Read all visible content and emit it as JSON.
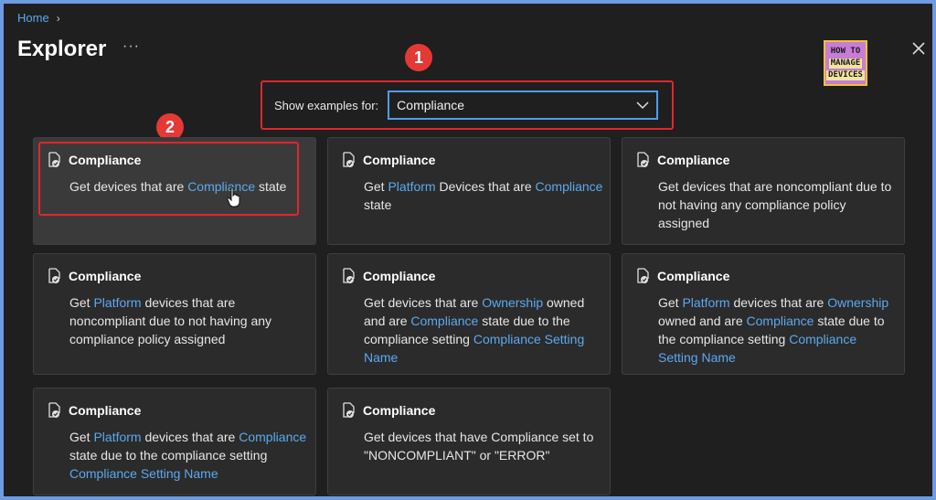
{
  "breadcrumb": {
    "home": "Home"
  },
  "header": {
    "title": "Explorer",
    "more": "···"
  },
  "logo": {
    "line1": "HOW TO",
    "line2": "MANAGE",
    "line3": "DEVICES"
  },
  "selector": {
    "label": "Show examples for:",
    "value": "Compliance"
  },
  "annotations": {
    "badge1": "1",
    "badge2": "2"
  },
  "cards": [
    {
      "title": "Compliance",
      "desc": [
        {
          "t": "Get devices that are "
        },
        {
          "t": "Compliance",
          "hl": true
        },
        {
          "t": " state"
        }
      ]
    },
    {
      "title": "Compliance",
      "desc": [
        {
          "t": "Get "
        },
        {
          "t": "Platform",
          "hl": true
        },
        {
          "t": " Devices that are "
        },
        {
          "t": "Compliance",
          "hl": true
        },
        {
          "t": " state"
        }
      ]
    },
    {
      "title": "Compliance",
      "desc": [
        {
          "t": "Get devices that are noncompliant due to not having any compliance policy assigned"
        }
      ]
    },
    {
      "title": "Compliance",
      "desc": [
        {
          "t": "Get "
        },
        {
          "t": "Platform",
          "hl": true
        },
        {
          "t": " devices that are noncompliant due to not having any compliance policy assigned"
        }
      ]
    },
    {
      "title": "Compliance",
      "desc": [
        {
          "t": "Get devices that are "
        },
        {
          "t": "Ownership",
          "hl": true
        },
        {
          "t": " owned and are "
        },
        {
          "t": "Compliance",
          "hl": true
        },
        {
          "t": " state due to the compliance setting "
        },
        {
          "t": "Compliance Setting Name",
          "hl": true
        }
      ]
    },
    {
      "title": "Compliance",
      "desc": [
        {
          "t": "Get "
        },
        {
          "t": "Platform",
          "hl": true
        },
        {
          "t": " devices that are "
        },
        {
          "t": "Ownership",
          "hl": true
        },
        {
          "t": " owned and are "
        },
        {
          "t": "Compliance",
          "hl": true
        },
        {
          "t": " state due to the compliance setting "
        },
        {
          "t": "Compliance Setting Name",
          "hl": true
        }
      ]
    },
    {
      "title": "Compliance",
      "desc": [
        {
          "t": "Get "
        },
        {
          "t": "Platform",
          "hl": true
        },
        {
          "t": " devices that are "
        },
        {
          "t": "Compliance",
          "hl": true
        },
        {
          "t": " state due to the compliance setting "
        },
        {
          "t": "Compliance Setting Name",
          "hl": true
        }
      ]
    },
    {
      "title": "Compliance",
      "desc": [
        {
          "t": "Get devices that have Compliance set to \"NONCOMPLIANT\" or \"ERROR\""
        }
      ]
    }
  ]
}
